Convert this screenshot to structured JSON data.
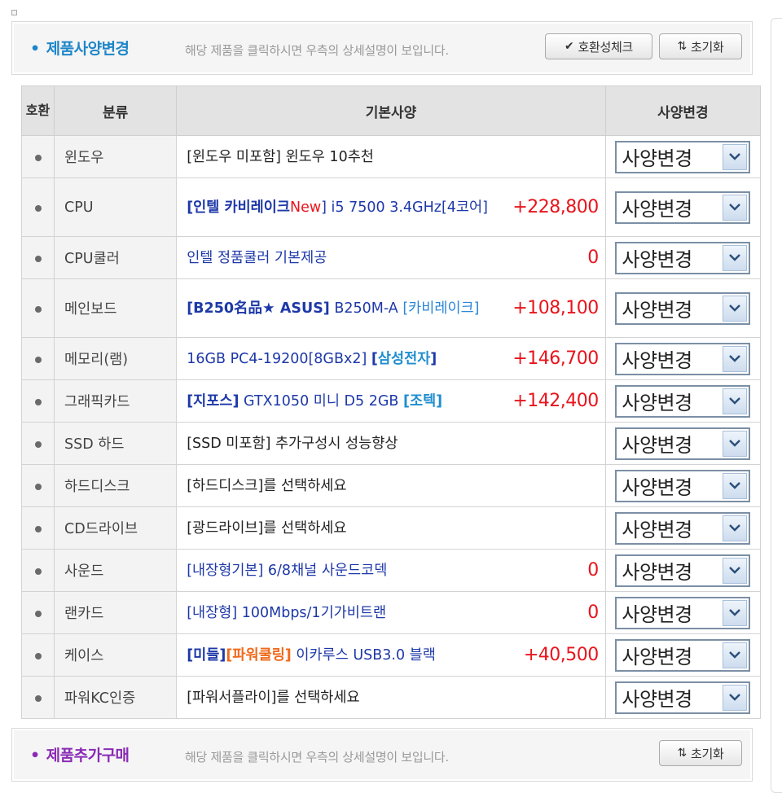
{
  "header": {
    "title": "제품사양변경",
    "description": "해당 제품을 클릭하시면 우측의 상세설명이 보입니다.",
    "compat_button": "호환성체크",
    "reset_button": "초기화"
  },
  "table": {
    "columns": {
      "compat": "호환",
      "category": "분류",
      "spec": "기본사양",
      "change": "사양변경"
    },
    "select_label": "사양변경",
    "rows": [
      {
        "category": "윈도우",
        "spec": [
          {
            "text": "[윈도우 미포함] 윈도우 10추천",
            "style": "black"
          }
        ],
        "price": ""
      },
      {
        "category": "CPU",
        "spec": [
          {
            "text": "[인텔 ",
            "style": "bold-blue"
          },
          {
            "text": "카비레이크",
            "style": "bold-blue"
          },
          {
            "text": "New",
            "style": "red"
          },
          {
            "text": "] i5 7500 3.4GHz[4코어]",
            "style": "blue"
          }
        ],
        "price": "+228,800"
      },
      {
        "category": "CPU쿨러",
        "spec": [
          {
            "text": "인텔 정품쿨러 기본제공",
            "style": "blue"
          }
        ],
        "price": "0"
      },
      {
        "category": "메인보드",
        "spec": [
          {
            "text": "[B250名品★ ASUS]",
            "style": "bold-blue"
          },
          {
            "text": " B250M-A ",
            "style": "blue"
          },
          {
            "text": "[카비레이크]",
            "style": "sky"
          }
        ],
        "price": "+108,100"
      },
      {
        "category": "메모리(램)",
        "spec": [
          {
            "text": "16GB PC4-19200[8GBx2] ",
            "style": "blue"
          },
          {
            "text": "[",
            "style": "bold-blue"
          },
          {
            "text": "삼성전자",
            "style": "bold-cyan"
          },
          {
            "text": "]",
            "style": "bold-blue"
          }
        ],
        "price": "+146,700"
      },
      {
        "category": "그래픽카드",
        "spec": [
          {
            "text": "[지포스]",
            "style": "bold-blue"
          },
          {
            "text": " GTX1050 미니 D5 2GB ",
            "style": "blue"
          },
          {
            "text": "[조텍]",
            "style": "bold-cyan"
          }
        ],
        "price": "+142,400"
      },
      {
        "category": "SSD 하드",
        "spec": [
          {
            "text": "[SSD 미포함] 추가구성시 성능향상",
            "style": "black"
          }
        ],
        "price": ""
      },
      {
        "category": "하드디스크",
        "spec": [
          {
            "text": "[하드디스크]를 선택하세요",
            "style": "black"
          }
        ],
        "price": ""
      },
      {
        "category": "CD드라이브",
        "spec": [
          {
            "text": "[광드라이브]를 선택하세요",
            "style": "black"
          }
        ],
        "price": ""
      },
      {
        "category": "사운드",
        "spec": [
          {
            "text": "[내장형기본] 6/8채널 사운드코덱",
            "style": "blue"
          }
        ],
        "price": "0"
      },
      {
        "category": "랜카드",
        "spec": [
          {
            "text": "[내장형] 100Mbps/1기가비트랜",
            "style": "blue"
          }
        ],
        "price": "0"
      },
      {
        "category": "케이스",
        "spec": [
          {
            "text": "[미들]",
            "style": "bold-blue"
          },
          {
            "text": "[파워쿨링]",
            "style": "orange-bold"
          },
          {
            "text": " 이카루스 USB3.0 블랙",
            "style": "blue"
          }
        ],
        "price": "+40,500"
      },
      {
        "category": "파워KC인증",
        "spec": [
          {
            "text": "[파워서플라이]를 선택하세요",
            "style": "black"
          }
        ],
        "price": ""
      }
    ]
  },
  "footer_section": {
    "title": "제품추가구매",
    "description": "해당 제품을 클릭하시면 우측의 상세설명이 보입니다.",
    "reset_button": "초기화"
  },
  "icons": {
    "bullet": "dot-icon",
    "compat_check": "check-icon",
    "reset": "sort-arrows-icon",
    "dropdown": "chevron-down-icon"
  },
  "colors": {
    "title_blue": "#1e86c8",
    "title_purple": "#8a2bb5",
    "price_red": "#e8141c",
    "text_blue": "#1d38a8",
    "accent_cyan": "#1f8ecf",
    "accent_orange": "#f06a1a"
  }
}
